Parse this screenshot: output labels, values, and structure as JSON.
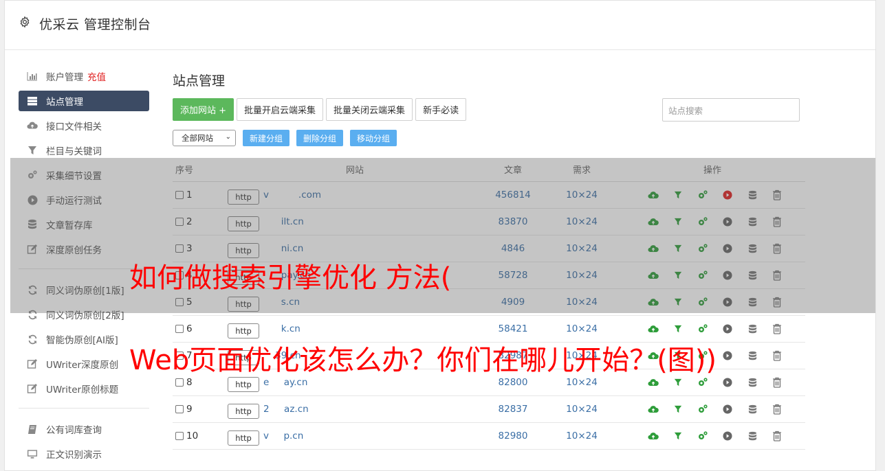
{
  "app": {
    "title": "优采云 管理控制台"
  },
  "sidebar": {
    "group1": [
      {
        "label": "账户管理",
        "extra": "充值",
        "icon": "bar-chart-icon"
      },
      {
        "label": "站点管理",
        "icon": "server-icon",
        "active": true
      },
      {
        "label": "接口文件相关",
        "icon": "cloud-upload-icon"
      },
      {
        "label": "栏目与关键词",
        "icon": "filter-icon"
      },
      {
        "label": "采集细节设置",
        "icon": "gears-icon"
      },
      {
        "label": "手动运行测试",
        "icon": "play-circle-icon"
      },
      {
        "label": "文章暂存库",
        "icon": "database-icon"
      },
      {
        "label": "深度原创任务",
        "icon": "edit-icon"
      }
    ],
    "group2": [
      {
        "label": "同义词伪原创[1版]",
        "icon": "refresh-icon"
      },
      {
        "label": "同义词伪原创[2版]",
        "icon": "refresh-icon"
      },
      {
        "label": "智能伪原创[AI版]",
        "icon": "refresh-icon"
      },
      {
        "label": "UWriter深度原创",
        "icon": "edit-icon"
      },
      {
        "label": "UWriter原创标题",
        "icon": "edit-icon"
      }
    ],
    "group3": [
      {
        "label": "公有词库查询",
        "icon": "book-icon"
      },
      {
        "label": "正文识别演示",
        "icon": "monitor-icon"
      }
    ]
  },
  "main": {
    "title": "站点管理",
    "buttons": {
      "add": "添加网站 +",
      "batch_open": "批量开启云端采集",
      "batch_close": "批量关闭云端采集",
      "guide": "新手必读"
    },
    "search_placeholder": "站点搜索",
    "group_select": "全部网站",
    "group_buttons": {
      "new": "新建分组",
      "delete": "删除分组",
      "move": "移动分组"
    }
  },
  "table": {
    "headers": {
      "no": "序号",
      "site": "网站",
      "articles": "文章",
      "demand": "需求",
      "ops": "操作"
    },
    "rows": [
      {
        "no": "1",
        "protocol": "http",
        "domain": "v          .com",
        "articles": "456814",
        "demand": "10×24",
        "play_active": true
      },
      {
        "no": "2",
        "protocol": "http",
        "domain": "      ilt.cn",
        "articles": "83870",
        "demand": "10×24",
        "play_active": false
      },
      {
        "no": "3",
        "protocol": "http",
        "domain": "      ni.cn",
        "articles": "4846",
        "demand": "10×24",
        "play_active": false
      },
      {
        "no": "4",
        "protocol": "http",
        "domain": "      pay.cn",
        "articles": "58728",
        "demand": "10×24",
        "play_active": false
      },
      {
        "no": "5",
        "protocol": "http",
        "domain": "      s.cn",
        "articles": "4909",
        "demand": "10×24",
        "play_active": false
      },
      {
        "no": "6",
        "protocol": "http",
        "domain": "      k.cn",
        "articles": "58421",
        "demand": "10×24",
        "play_active": false
      },
      {
        "no": "7",
        "protocol": "http",
        "domain": "    39.cn",
        "articles": "82987",
        "demand": "10×24",
        "play_active": false
      },
      {
        "no": "8",
        "protocol": "http",
        "domain": "e     ay.cn",
        "articles": "82800",
        "demand": "10×24",
        "play_active": false
      },
      {
        "no": "9",
        "protocol": "http",
        "domain": "2     az.cn",
        "articles": "82837",
        "demand": "10×24",
        "play_active": false
      },
      {
        "no": "10",
        "protocol": "http",
        "domain": "v     p.cn",
        "articles": "82980",
        "demand": "10×24",
        "play_active": false
      }
    ]
  },
  "overlay": {
    "line1": "如何做搜索引擎优化 方法(",
    "line2": "Web页面优化该怎么办？你们在哪儿开始？(图))"
  },
  "colors": {
    "sidebar_active": "#3c4b64",
    "add_button": "#5cb85c",
    "group_button": "#5aaef0",
    "link": "#3a6ea5",
    "overlay_text": "#ff0000",
    "op_upload": "#2e9d3a",
    "op_play_active": "#e02020"
  }
}
